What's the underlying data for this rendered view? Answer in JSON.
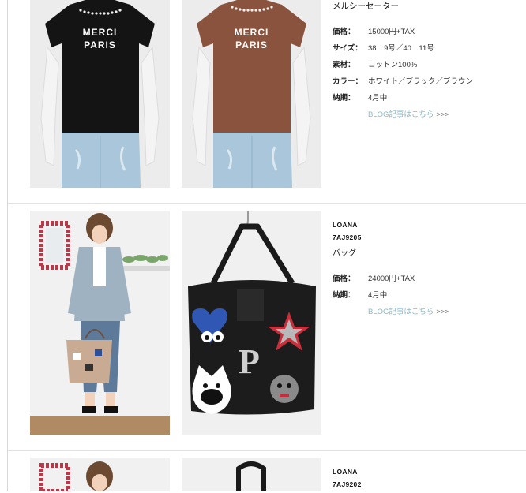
{
  "product1": {
    "name": "メルシーセーター",
    "rows": [
      {
        "label": "価格：",
        "value": "15000円+TAX"
      },
      {
        "label": "サイズ：",
        "value": "38　9号／40　11号"
      },
      {
        "label": "素材：",
        "value": "コットン100%"
      },
      {
        "label": "カラー：",
        "value": "ホワイト／ブラック／ブラウン"
      },
      {
        "label": "納期：",
        "value": "4月中"
      }
    ],
    "blog_link": "BLOG記事はこちら",
    "blog_arrows": ">>>",
    "shirt_text_line1": "MERCI",
    "shirt_text_line2": "PARIS",
    "colors": {
      "black": "#141414",
      "brown": "#8a533d"
    }
  },
  "product2": {
    "brand": "LOANA",
    "code": "7AJ9205",
    "name": "バッグ",
    "rows": [
      {
        "label": "価格：",
        "value": "24000円+TAX"
      },
      {
        "label": "納期：",
        "value": "4月中"
      }
    ],
    "blog_link": "BLOG記事はこちら",
    "blog_arrows": ">>>",
    "bag_letter": "P"
  },
  "product3": {
    "brand": "LOANA",
    "code": "7AJ9202"
  }
}
